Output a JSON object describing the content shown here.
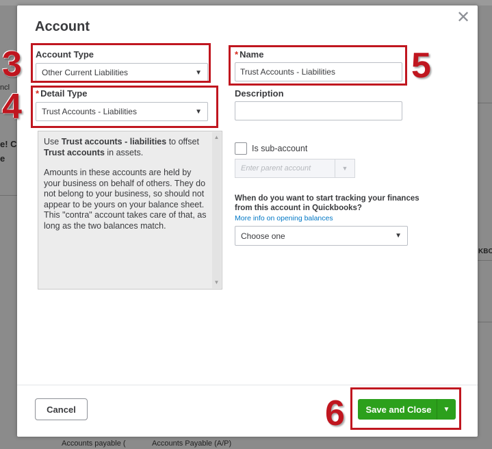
{
  "background": {
    "text_fragments": [
      "ncl",
      "e! C",
      "e",
      "KBO",
      "Accounts payable (",
      "Accounts Payable (A/P)"
    ]
  },
  "modal": {
    "title": "Account",
    "close_symbol": "✕",
    "account_type": {
      "label": "Account Type",
      "value": "Other Current Liabilities"
    },
    "detail_type": {
      "required_mark": "*",
      "label": "Detail Type",
      "value": "Trust Accounts - Liabilities"
    },
    "name": {
      "required_mark": "*",
      "label": "Name",
      "value": "Trust Accounts - Liabilities"
    },
    "description": {
      "label": "Description",
      "value": ""
    },
    "help": {
      "p1_a": "Use ",
      "p1_b": "Trust accounts - liabilities",
      "p1_c": " to offset ",
      "p1_d": "Trust accounts",
      "p1_e": " in assets.",
      "p2": "Amounts in these accounts are held by your business on behalf of others. They do not belong to your business, so should not appear to be yours on your balance sheet. This \"contra\" account takes care of that, as long as the two balances match."
    },
    "sub_account": {
      "label": "Is sub-account",
      "checked": false,
      "parent_placeholder": "Enter parent account"
    },
    "tracking": {
      "question": "When do you want to start tracking your finances from this account in Quickbooks?",
      "link": "More info on opening balances",
      "select_value": "Choose one"
    },
    "footer": {
      "cancel_label": "Cancel",
      "save_label": "Save and Close"
    }
  },
  "callouts": [
    "3",
    "4",
    "5",
    "6"
  ],
  "colors": {
    "callout": "#c0161f",
    "primary_button": "#2ca01c",
    "link": "#0077c5",
    "required": "#d52b1e"
  }
}
